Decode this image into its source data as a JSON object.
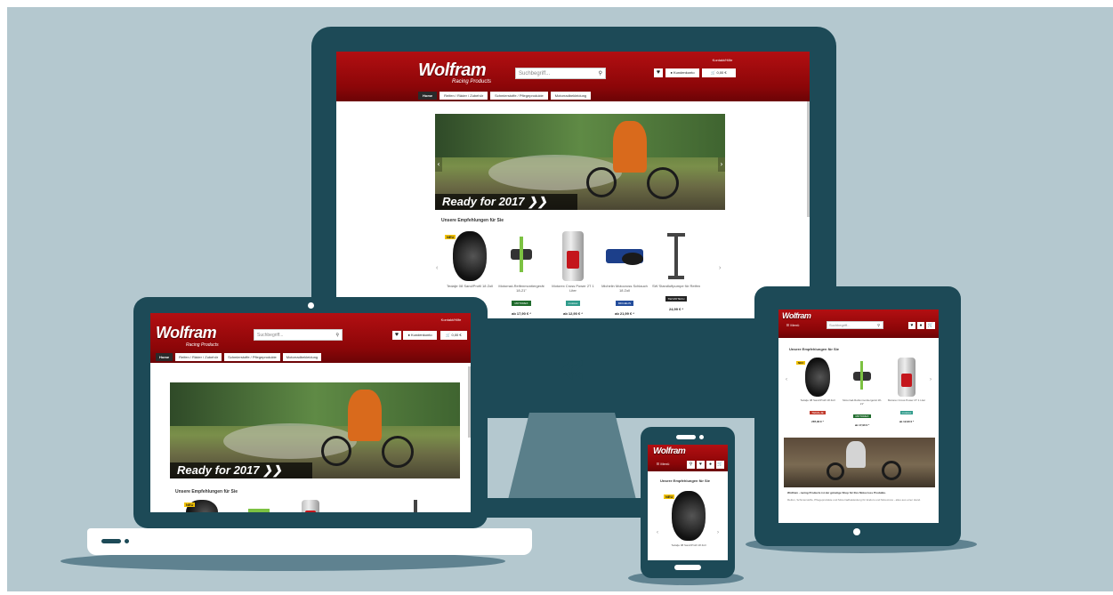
{
  "site": {
    "logo": "Wolfram",
    "logo_sub": "Racing Products",
    "search_placeholder": "Suchbegriff...",
    "account_label": "Kundenkonto",
    "cart_label": "0,00 €",
    "top_link": "Kontakt/Hilfe",
    "nav": [
      "Home",
      "Reifen / Räder / Zubehör",
      "Schmierstoffe / Pflegeprodukte",
      "Motorradbekleidung"
    ],
    "mobile_menu": "Menü"
  },
  "hero": {
    "caption": "Ready for 2017 ❯❯"
  },
  "recommendations": {
    "title": "Unsere Empfehlungen für Sie",
    "badge_new": "NEU",
    "products": [
      {
        "name": "Tedalje 08 Sand/Profil 18 Zoll",
        "brand": "TEDALJE",
        "brand_color": "#c0392b",
        "price": "287,90 € *",
        "type": "tire"
      },
      {
        "name": "Motorrad-Reifenmontiergerät 18-21\"",
        "brand": "MOTOREX",
        "brand_color": "#1f6b2c",
        "price": "ab 17,90 € *",
        "type": "stand"
      },
      {
        "name": "Motorex Cross Power 2T 1 Liter",
        "brand": "motorex",
        "brand_color": "#2f9b8b",
        "price": "ab 12,90 € *",
        "type": "oil"
      },
      {
        "name": "Michelin Motocross Schlauch 18 Zoll",
        "brand": "MICHELIN",
        "brand_color": "#234d9c",
        "price": "ab 21,99 € *",
        "type": "tube"
      },
      {
        "name": "SW Standluftpumpe für Reifen",
        "brand": "SW-MOTECH",
        "brand_color": "#222222",
        "price": "24,99 € *",
        "type": "pump"
      }
    ]
  },
  "tablet_text": {
    "heading": "Wolfram - racing Products ist der günstige Shop für Ihre Motocross Produkte.",
    "body": "Reifen, Schmierstoffe, Pflegeprodukte und Motorradbekleidung für Enduro und Motocross - alles aus einer Hand."
  },
  "decor": {
    "chevron": "«"
  }
}
